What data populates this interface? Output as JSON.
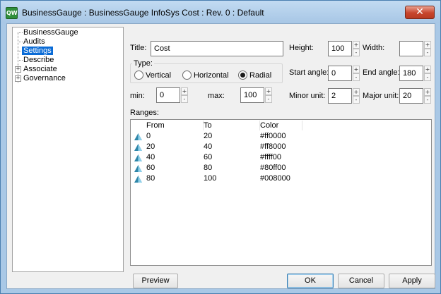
{
  "window": {
    "title": "BusinessGauge : BusinessGauge InfoSys Cost : Rev. 0  : Default",
    "icon_text": "QW",
    "close_glyph": "✕"
  },
  "tree": {
    "items": [
      {
        "label": "BusinessGauge",
        "selected": false,
        "expandable": false
      },
      {
        "label": "Audits",
        "selected": false,
        "expandable": false
      },
      {
        "label": "Settings",
        "selected": true,
        "expandable": false
      },
      {
        "label": "Describe",
        "selected": false,
        "expandable": false
      },
      {
        "label": "Associate",
        "selected": false,
        "expandable": true
      },
      {
        "label": "Governance",
        "selected": false,
        "expandable": true
      }
    ],
    "expander_glyph": "+"
  },
  "form": {
    "title_label": "Title:",
    "title_value": "Cost",
    "type_label": "Type:",
    "type_options": [
      {
        "label": "Vertical",
        "checked": false
      },
      {
        "label": "Horizontal",
        "checked": false
      },
      {
        "label": "Radial",
        "checked": true
      }
    ],
    "min_label": "min:",
    "min_value": "0",
    "max_label": "max:",
    "max_value": "100",
    "height_label": "Height:",
    "height_value": "100",
    "width_label": "Width:",
    "width_value": "",
    "start_angle_label": "Start angle:",
    "start_angle_value": "0",
    "end_angle_label": "End angle:",
    "end_angle_value": "180",
    "minor_unit_label": "Minor unit:",
    "minor_unit_value": "2",
    "major_unit_label": "Major unit:",
    "major_unit_value": "20",
    "spin_up": "+",
    "spin_down": "-"
  },
  "ranges": {
    "label": "Ranges:",
    "columns": [
      "From",
      "To",
      "Color"
    ],
    "rows": [
      {
        "from": "0",
        "to": "20",
        "color": "#ff0000"
      },
      {
        "from": "20",
        "to": "40",
        "color": "#ff8000"
      },
      {
        "from": "40",
        "to": "60",
        "color": "#ffff00"
      },
      {
        "from": "60",
        "to": "80",
        "color": "#80ff00"
      },
      {
        "from": "80",
        "to": "100",
        "color": "#008000"
      }
    ]
  },
  "buttons": {
    "preview": "Preview",
    "ok": "OK",
    "cancel": "Cancel",
    "apply": "Apply"
  }
}
